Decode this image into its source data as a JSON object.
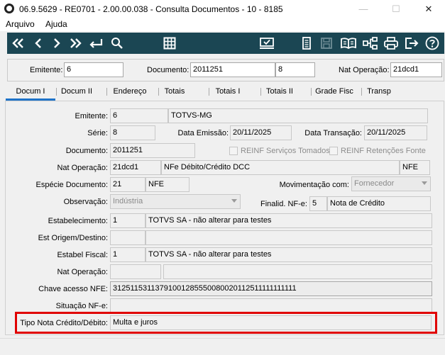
{
  "window": {
    "title": "06.9.5629 - RE0701 - 2.00.00.038 - Consulta Documentos - 10 - 8185",
    "minimize": "—",
    "maximize": "☐",
    "close": "✕"
  },
  "menu": [
    "Arquivo",
    "Ajuda"
  ],
  "toolbar": {
    "icons": [
      "first-icon",
      "previous-icon",
      "next-icon",
      "last-icon",
      "enter-icon",
      "search-icon",
      "grid-icon",
      "checked-screen-icon",
      "document-icon",
      "save-icon",
      "open-book-icon",
      "tree-icon",
      "print-icon",
      "exit-icon",
      "help-icon"
    ],
    "colors": {
      "background": "#1b4653",
      "icon": "#ffffff",
      "disabled_icon": "#6f8d96"
    }
  },
  "header": {
    "emitente_label": "Emitente:",
    "emitente_value": "6",
    "documento_label": "Documento:",
    "documento_value": "2011251",
    "documento_serie": "8",
    "nat_operacao_label": "Nat Operação:",
    "nat_operacao_value": "21dcd1"
  },
  "tabs": [
    "Docum I",
    "Docum II",
    "Endereço",
    "Totais",
    "Totais I",
    "Totais II",
    "Grade Fisc",
    "Transp"
  ],
  "active_tab": "Docum I",
  "form": {
    "emitente": {
      "label": "Emitente:",
      "code": "6",
      "name": "TOTVS-MG"
    },
    "serie": {
      "label": "Série:",
      "value": "8"
    },
    "data_emissao": {
      "label": "Data Emissão:",
      "value": "20/11/2025"
    },
    "data_transacao": {
      "label": "Data Transação:",
      "value": "20/11/2025"
    },
    "documento": {
      "label": "Documento:",
      "value": "2011251"
    },
    "reinf_servicos": "REINF Serviços Tomados",
    "reinf_retencoes": "REINF Retenções Fonte",
    "nat_operacao": {
      "label": "Nat Operação:",
      "code": "21dcd1",
      "desc": "NFe Débito/Crédito DCC",
      "tipo": "NFE"
    },
    "especie": {
      "label": "Espécie Documento:",
      "code": "21",
      "desc": "NFE"
    },
    "movimentacao": {
      "label": "Movimentação com:",
      "value": "Fornecedor"
    },
    "observacao": {
      "label": "Observação:",
      "value": "Indústria"
    },
    "finalid": {
      "label": "Finalid. NF-e:",
      "code": "5",
      "desc": "Nota de Crédito"
    },
    "estabelecimento": {
      "label": "Estabelecimento:",
      "code": "1",
      "desc": "TOTVS SA - não alterar para testes"
    },
    "est_origem": {
      "label": "Est Origem/Destino:",
      "code": "",
      "desc": ""
    },
    "estabel_fiscal": {
      "label": "Estabel Fiscal:",
      "code": "1",
      "desc": "TOTVS SA - não alterar para testes"
    },
    "nat_operacao2": {
      "label": "Nat Operação:",
      "code": "",
      "desc": ""
    },
    "chave_acesso": {
      "label": "Chave acesso NFE:",
      "value": "31251153113791001285550080020112511111111111"
    },
    "situacao": {
      "label": "Situação NF-e:",
      "value": ""
    },
    "tipo_nota": {
      "label": "Tipo Nota Crédito/Débito:",
      "value": "Multa e juros"
    }
  },
  "colors": {
    "highlight": "#e00000",
    "tab_active": "#1e73c8"
  }
}
